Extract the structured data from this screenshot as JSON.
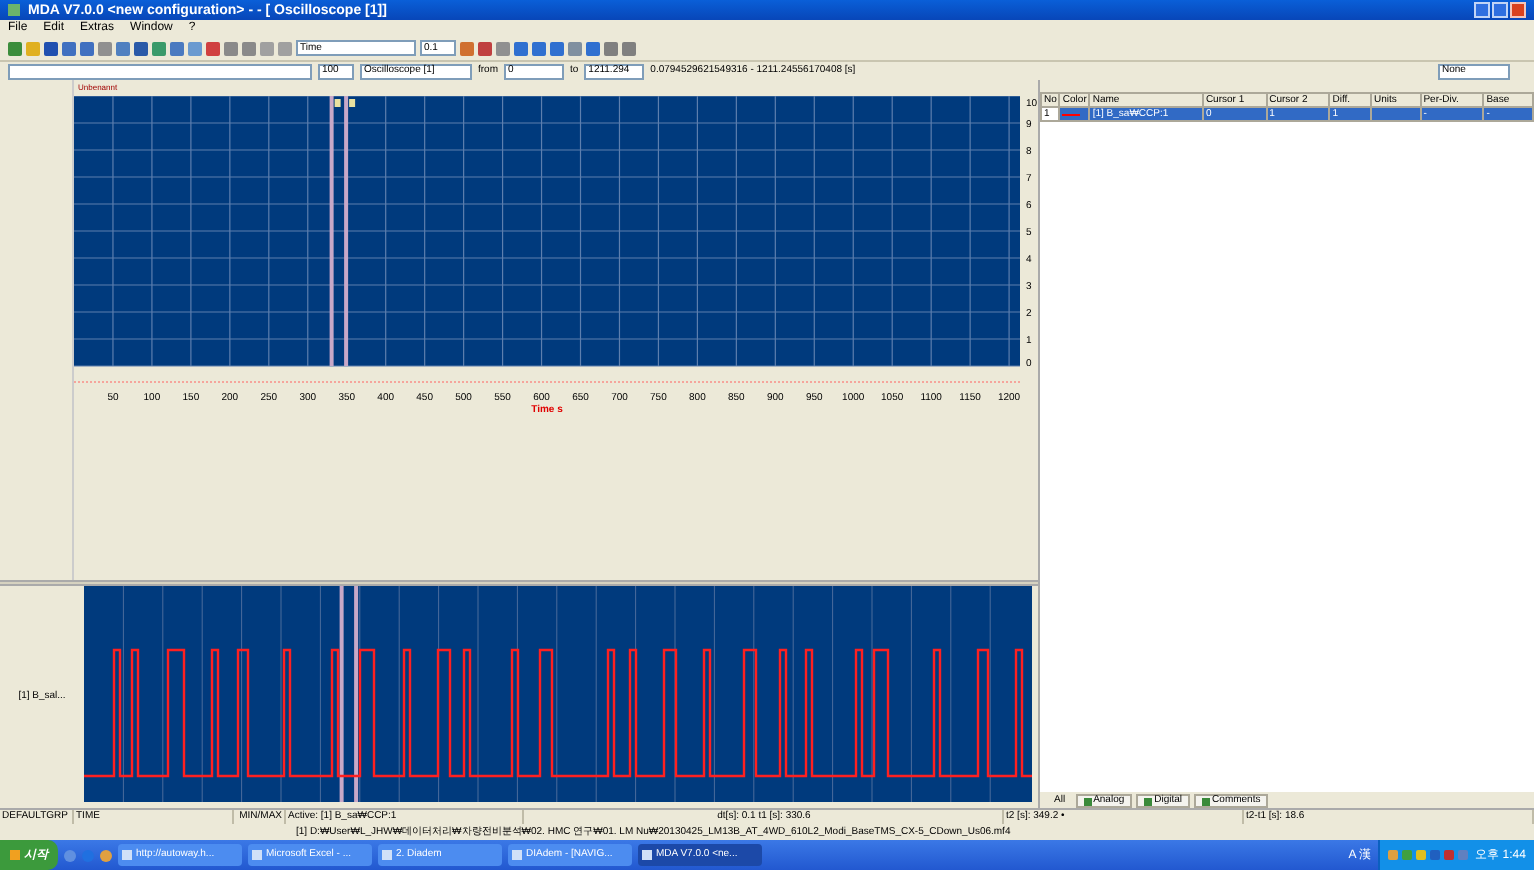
{
  "window": {
    "title": "MDA V7.0.0   <new configuration> - - [ Oscilloscope [1]]"
  },
  "menu": [
    "File",
    "Edit",
    "Extras",
    "Window",
    "?"
  ],
  "toolbar": {
    "axis_select": "Time",
    "step": "0.1"
  },
  "toolbar2": {
    "zoom": "100",
    "view_select": "Oscilloscope [1]",
    "from_label": "from",
    "from": "0",
    "to_label": "to",
    "to": "1211.294",
    "range": "0.0794529621549316 - 1211.24556170408 [s]",
    "filter": "None"
  },
  "oscilloscope": {
    "title": "Unbenannt",
    "signal_label": "[1] B_sal...",
    "chart_data": {
      "type": "line",
      "xlabel": "Time  s",
      "xlim": [
        0,
        1214
      ],
      "ylim": [
        0,
        10
      ],
      "xticks": [
        50,
        100,
        150,
        200,
        250,
        300,
        350,
        400,
        450,
        500,
        550,
        600,
        650,
        700,
        750,
        800,
        850,
        900,
        950,
        1000,
        1050,
        1100,
        1150,
        1200
      ],
      "yticks": [
        0,
        1,
        2,
        3,
        4,
        5,
        6,
        7,
        8,
        9,
        10
      ],
      "grid": true,
      "ref_lines": [
        {
          "axis": "x",
          "value": 330.6
        },
        {
          "axis": "x",
          "value": 349.2
        }
      ]
    }
  },
  "channel_table": {
    "columns": [
      "No",
      "Color",
      "Name",
      "Cursor 1",
      "Cursor 2",
      "Diff.",
      "Units",
      "Per-Div.",
      "Base"
    ],
    "rows": [
      {
        "no": "1",
        "color": "#ff0000",
        "name": "[1] B_sa₩CCP:1",
        "cursor_1": "0",
        "cursor_2": "1",
        "diff": "1",
        "per_div": "-",
        "base": "-",
        "selected": true
      }
    ]
  },
  "panel_tabs": [
    {
      "label": "All",
      "selected": true
    },
    {
      "label": "Analog",
      "selected": false
    },
    {
      "label": "Digital",
      "selected": false
    },
    {
      "label": "Comments",
      "selected": false
    }
  ],
  "status_bar": {
    "fields": [
      "DEFAULTGRP",
      "TIME",
      "MIN/MAX",
      "Active:  [1]  B_sa₩CCP:1",
      "dt[s]: 0.1 t1 [s]: 330.6",
      "t2 [s]: 349.2 •",
      "t2-t1 [s]: 18.6"
    ],
    "file": "[1]  D:₩User₩L_JHW₩데이터처리₩차량전비분석₩02. HMC 연구₩01. LM Nu₩20130425_LM13B_AT_4WD_610L2_Modi_BaseTMS_CX-5_CDown_Us06.mf4"
  },
  "taskbar": {
    "start": "시작",
    "tasks": [
      {
        "label": "http://autoway.h...",
        "selected": false
      },
      {
        "label": "Microsoft Excel - ...",
        "selected": false
      },
      {
        "label": "2. Diadem",
        "selected": false
      },
      {
        "label": "DIAdem - [NAVIG...",
        "selected": false
      },
      {
        "label": "MDA V7.0.0  <ne...",
        "selected": true
      }
    ],
    "ime": "A 漢",
    "clock": "오후 1:44"
  }
}
